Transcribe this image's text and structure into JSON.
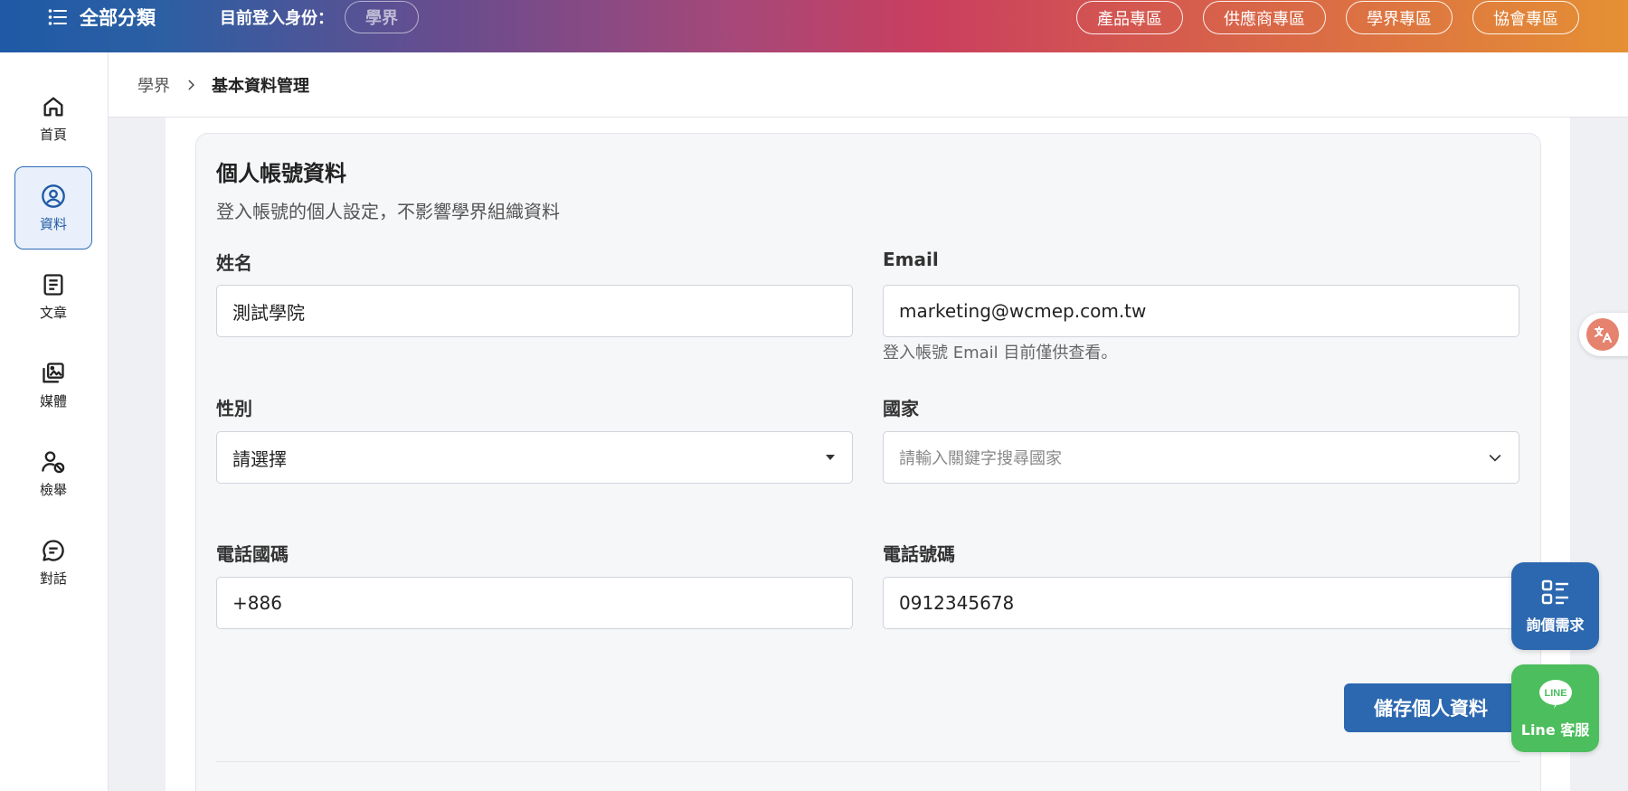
{
  "topbar": {
    "menu_label": "全部分類",
    "identity_label": "目前登入身份：",
    "identity_value": "學界",
    "nav": [
      "產品專區",
      "供應商專區",
      "學界專區",
      "協會專區"
    ]
  },
  "sidebar": {
    "items": [
      {
        "label": "首頁",
        "icon": "home-icon"
      },
      {
        "label": "資料",
        "icon": "user-circle-icon",
        "active": true
      },
      {
        "label": "文章",
        "icon": "document-icon"
      },
      {
        "label": "媒體",
        "icon": "media-icon"
      },
      {
        "label": "檢舉",
        "icon": "report-user-icon"
      },
      {
        "label": "對話",
        "icon": "chat-icon"
      }
    ]
  },
  "breadcrumb": {
    "root": "學界",
    "current": "基本資料管理"
  },
  "form": {
    "title": "個人帳號資料",
    "subtitle": "登入帳號的個人設定，不影響學界組織資料",
    "name_label": "姓名",
    "name_value": "測試學院",
    "email_label": "Email",
    "email_value": "marketing@wcmep.com.tw",
    "email_helper": "登入帳號 Email 目前僅供查看。",
    "gender_label": "性別",
    "gender_value": "請選擇",
    "country_label": "國家",
    "country_placeholder": "請輸入關鍵字搜尋國家",
    "phone_code_label": "電話國碼",
    "phone_code_value": "+886",
    "phone_label": "電話號碼",
    "phone_value": "0912345678",
    "save_label": "儲存個人資料"
  },
  "floating": {
    "quote_label": "詢價需求",
    "line_label": "Line 客服"
  },
  "colors": {
    "primary": "#2c68b0",
    "line_green": "#4cbe5d",
    "translate_accent": "#e6836f"
  }
}
